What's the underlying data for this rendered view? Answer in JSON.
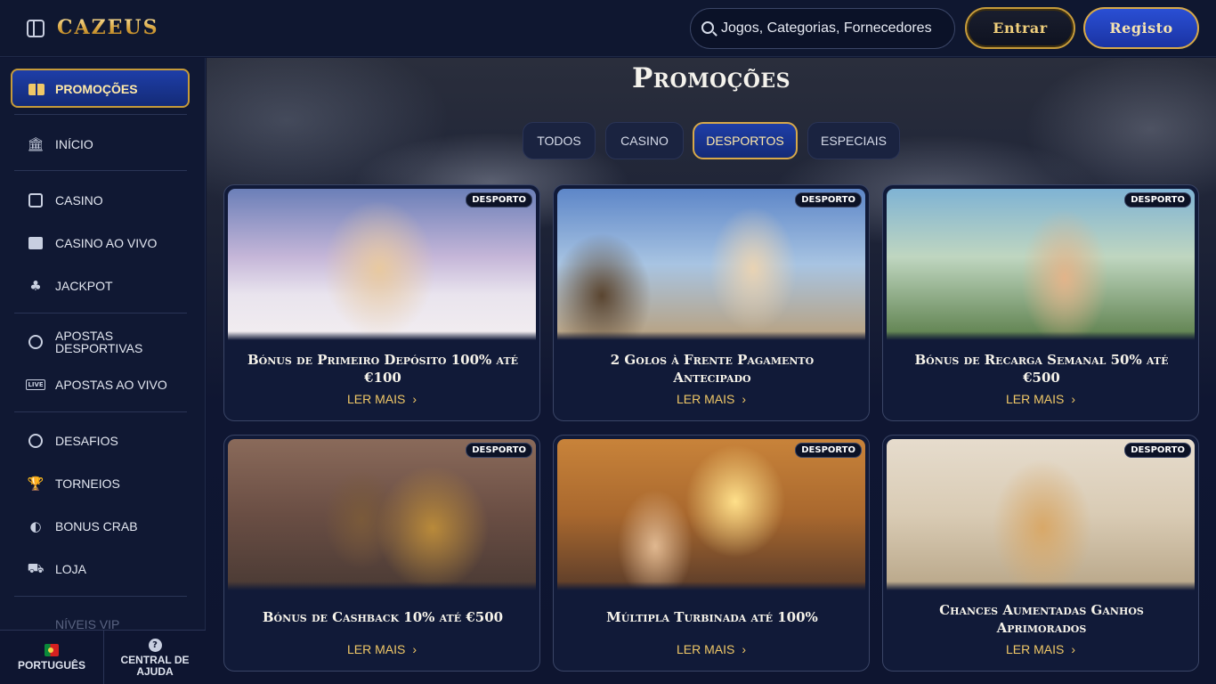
{
  "header": {
    "logo_text": "CAZEUS",
    "search_placeholder": "Jogos, Categorias, Fornecedores",
    "login_label": "Entrar",
    "register_label": "Registo"
  },
  "sidebar": {
    "promo_label": "PROMOÇÕES",
    "items": [
      {
        "label": "INÍCIO",
        "icon": "bank-icon"
      },
      {
        "label": "CASINO",
        "icon": "slot-machine-icon"
      },
      {
        "label": "CASINO AO VIVO",
        "icon": "cards-icon"
      },
      {
        "label": "JACKPOT",
        "icon": "clover-icon"
      },
      {
        "label": "APOSTAS DESPORTIVAS",
        "icon": "soccer-ball-icon"
      },
      {
        "label": "APOSTAS AO VIVO",
        "icon": "live-icon"
      },
      {
        "label": "DESAFIOS",
        "icon": "medal-icon"
      },
      {
        "label": "TORNEIOS",
        "icon": "trophy-icon"
      },
      {
        "label": "BONUS CRAB",
        "icon": "crab-icon"
      },
      {
        "label": "LOJA",
        "icon": "cart-icon"
      }
    ],
    "vip_label": "NÍVEIS VIP",
    "footer": {
      "language": "PORTUGUÊS",
      "help": "CENTRAL DE AJUDA"
    }
  },
  "main": {
    "title": "Promoções",
    "tabs": [
      {
        "label": "TODOS",
        "active": false
      },
      {
        "label": "CASINO",
        "active": false
      },
      {
        "label": "DESPORTOS",
        "active": true
      },
      {
        "label": "ESPECIAIS",
        "active": false
      }
    ],
    "cards": [
      {
        "badge": "DESPORTO",
        "title": "Bónus de Primeiro Depósito 100% até €100",
        "cta": "LER MAIS"
      },
      {
        "badge": "DESPORTO",
        "title": "2 Golos à Frente Pagamento Antecipado",
        "cta": "LER MAIS"
      },
      {
        "badge": "DESPORTO",
        "title": "Bónus de Recarga Semanal 50% até €500",
        "cta": "LER MAIS"
      },
      {
        "badge": "DESPORTO",
        "title": "Bónus de Cashback 10% até €500",
        "cta": "LER MAIS"
      },
      {
        "badge": "DESPORTO",
        "title": "Múltipla Turbinada até 100%",
        "cta": "LER MAIS"
      },
      {
        "badge": "DESPORTO",
        "title": "Chances Aumentadas Ganhos Aprimorados",
        "cta": "LER MAIS"
      }
    ]
  },
  "colors": {
    "accent_gold": "#f0c867",
    "active_blue": "#1e3ea8",
    "background": "#0e1530"
  }
}
